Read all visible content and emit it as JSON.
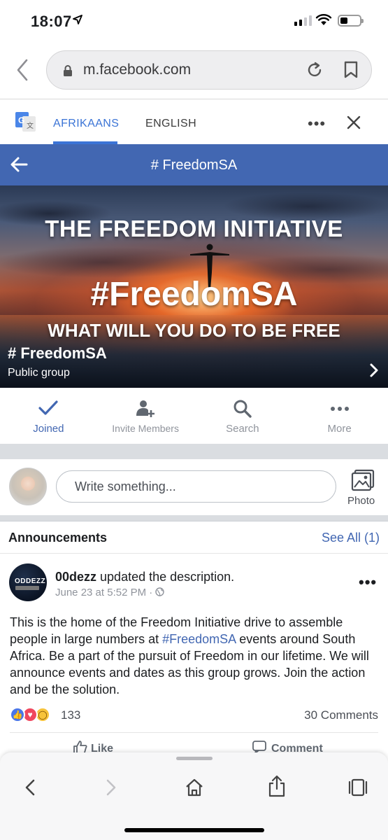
{
  "status": {
    "time": "18:07",
    "location_icon": "location-arrow-icon"
  },
  "browser": {
    "url": "m.facebook.com"
  },
  "translate": {
    "tab_source": "AFRIKAANS",
    "tab_target": "ENGLISH"
  },
  "header": {
    "title": "# FreedomSA"
  },
  "cover": {
    "line1": "THE FREEDOM INITIATIVE",
    "line2": "#FreedomSA",
    "line3": "WHAT WILL YOU DO TO BE FREE",
    "group_name": "# FreedomSA",
    "group_type": "Public group"
  },
  "actions": [
    {
      "label": "Joined",
      "icon": "check-icon"
    },
    {
      "label": "Invite Members",
      "icon": "add-person-icon"
    },
    {
      "label": "Search",
      "icon": "search-icon"
    },
    {
      "label": "More",
      "icon": "more-dots-icon"
    }
  ],
  "composer": {
    "placeholder": "Write something...",
    "photo_label": "Photo"
  },
  "announcements": {
    "title": "Announcements",
    "see_all": "See All (1)",
    "post": {
      "avatar_text": "ODDEZZ",
      "author": "00dezz",
      "action": " updated the description.",
      "meta": "June 23 at 5:52 PM · ",
      "text_before": "This is the home of the Freedom Initiative drive to assemble people in large numbers at ",
      "hashtag": "#FreedomSA",
      "text_after": " events around South Africa. Be a part of the pursuit of Freedom in our lifetime. We will announce events and dates as this group grows. Join the action and be the solution.",
      "reactions_count": "133",
      "comments": "30 Comments",
      "like_label": "Like",
      "comment_label": "Comment"
    }
  },
  "colors": {
    "fb_blue": "#4267b2",
    "translate_blue": "#3b74d6",
    "separator": "#dadde1"
  }
}
